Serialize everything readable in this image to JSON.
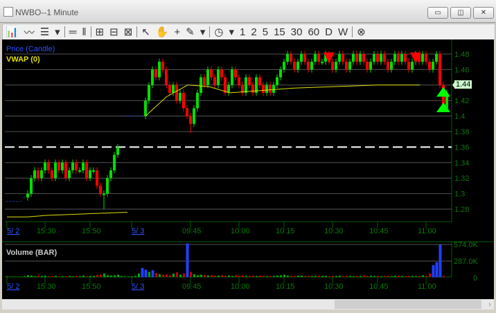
{
  "window": {
    "title": "NWBO--1 Minute",
    "min": "▭",
    "restore": "◫",
    "close": "✕"
  },
  "toolbar": {
    "items": [
      "📊",
      "〰",
      "☰",
      "▾",
      "|",
      "═",
      "‖",
      "|",
      "⊞",
      "⊟",
      "⊠",
      "|",
      "↖",
      "✋",
      "+",
      "✎",
      "▾",
      "|",
      "◷",
      "▾",
      "1",
      "2",
      "5",
      "15",
      "30",
      "60",
      "D",
      "W",
      "|",
      "⊗"
    ]
  },
  "legend": {
    "price": "Price (Candle)",
    "vwap": "VWAP (0)",
    "volume": "Volume (BAR)"
  },
  "colors": {
    "up": "#00e000",
    "down": "#ff0000",
    "vwap": "#e0e000",
    "axis": "#006000",
    "axistext": "#0a7a0a"
  },
  "last_price": "1.44",
  "chart_data": {
    "type": "candlestick",
    "price_ticks": [
      "1.48",
      "1.46",
      "1.44",
      "1.42",
      "1.4",
      "1.38",
      "1.36",
      "1.34",
      "1.32",
      "1.3",
      "1.28"
    ],
    "ylim": [
      1.265,
      1.495
    ],
    "time_labels": [
      {
        "t": "5/ 2",
        "i": 0,
        "date": true
      },
      {
        "t": "15:30",
        "i": 11
      },
      {
        "t": "15:50",
        "i": 24
      },
      {
        "t": "5/ 3",
        "i": 36,
        "date": true
      },
      {
        "t": "09:45",
        "i": 53
      },
      {
        "t": "10:00",
        "i": 67
      },
      {
        "t": "10:15",
        "i": 80
      },
      {
        "t": "10:30",
        "i": 94
      },
      {
        "t": "10:45",
        "i": 107
      },
      {
        "t": "11:00",
        "i": 121
      }
    ],
    "closes": [
      1.29,
      1.29,
      1.29,
      1.29,
      1.29,
      1.295,
      1.3,
      1.32,
      1.33,
      1.32,
      1.33,
      1.34,
      1.33,
      1.32,
      1.34,
      1.33,
      1.34,
      1.32,
      1.33,
      1.34,
      1.33,
      1.33,
      1.34,
      1.32,
      1.33,
      1.33,
      1.31,
      1.3,
      1.3,
      1.32,
      1.33,
      1.35,
      1.36,
      1.4,
      1.4,
      1.4,
      1.4,
      1.4,
      1.4,
      1.4,
      1.42,
      1.44,
      1.46,
      1.45,
      1.47,
      1.46,
      1.44,
      1.43,
      1.44,
      1.42,
      1.43,
      1.41,
      1.4,
      1.39,
      1.41,
      1.43,
      1.45,
      1.44,
      1.46,
      1.45,
      1.44,
      1.46,
      1.45,
      1.43,
      1.44,
      1.46,
      1.45,
      1.44,
      1.43,
      1.45,
      1.44,
      1.43,
      1.45,
      1.44,
      1.43,
      1.44,
      1.43,
      1.44,
      1.45,
      1.46,
      1.47,
      1.48,
      1.47,
      1.46,
      1.47,
      1.48,
      1.47,
      1.46,
      1.47,
      1.48,
      1.47,
      1.47,
      1.48,
      1.47,
      1.46,
      1.47,
      1.48,
      1.47,
      1.46,
      1.47,
      1.48,
      1.47,
      1.48,
      1.47,
      1.46,
      1.47,
      1.48,
      1.47,
      1.48,
      1.47,
      1.46,
      1.47,
      1.48,
      1.47,
      1.48,
      1.47,
      1.46,
      1.47,
      1.48,
      1.47,
      1.48,
      1.47,
      1.46,
      1.47,
      1.48,
      1.44,
      1.41,
      1.43
    ],
    "volume_k": [
      10,
      5,
      8,
      5,
      6,
      12,
      30,
      25,
      15,
      20,
      18,
      22,
      12,
      15,
      20,
      10,
      14,
      12,
      18,
      10,
      20,
      15,
      25,
      12,
      18,
      20,
      35,
      40,
      60,
      30,
      25,
      30,
      40,
      15,
      10,
      8,
      12,
      20,
      60,
      150,
      120,
      90,
      110,
      70,
      50,
      40,
      45,
      30,
      60,
      80,
      40,
      60,
      574,
      90,
      50,
      30,
      40,
      35,
      25,
      30,
      20,
      25,
      30,
      20,
      25,
      18,
      30,
      20,
      25,
      18,
      20,
      22,
      18,
      25,
      20,
      15,
      20,
      18,
      25,
      30,
      40,
      25,
      20,
      18,
      22,
      25,
      20,
      18,
      15,
      20,
      25,
      18,
      20,
      15,
      20,
      18,
      22,
      15,
      20,
      18,
      15,
      20,
      18,
      25,
      15,
      20,
      18,
      20,
      15,
      18,
      20,
      15,
      20,
      25,
      18,
      15,
      20,
      18,
      15,
      20,
      30,
      20,
      60,
      200,
      250,
      550,
      20
    ],
    "vwap": [
      1.27,
      1.27,
      1.272,
      1.273,
      1.274,
      1.275,
      1.276,
      null,
      1.4,
      1.425,
      1.44,
      1.438,
      1.43,
      1.432,
      1.434,
      1.436,
      1.437,
      1.438,
      1.439,
      1.44,
      1.44,
      1.44
    ],
    "volume_ticks": [
      "574.0K",
      "287.0K",
      "0"
    ],
    "signals": [
      {
        "type": "sell",
        "i": 93
      },
      {
        "type": "sell",
        "i": 118
      },
      {
        "type": "buy",
        "i": 126,
        "price": 1.425
      },
      {
        "type": "buy",
        "i": 126,
        "price": 1.405
      }
    ]
  }
}
